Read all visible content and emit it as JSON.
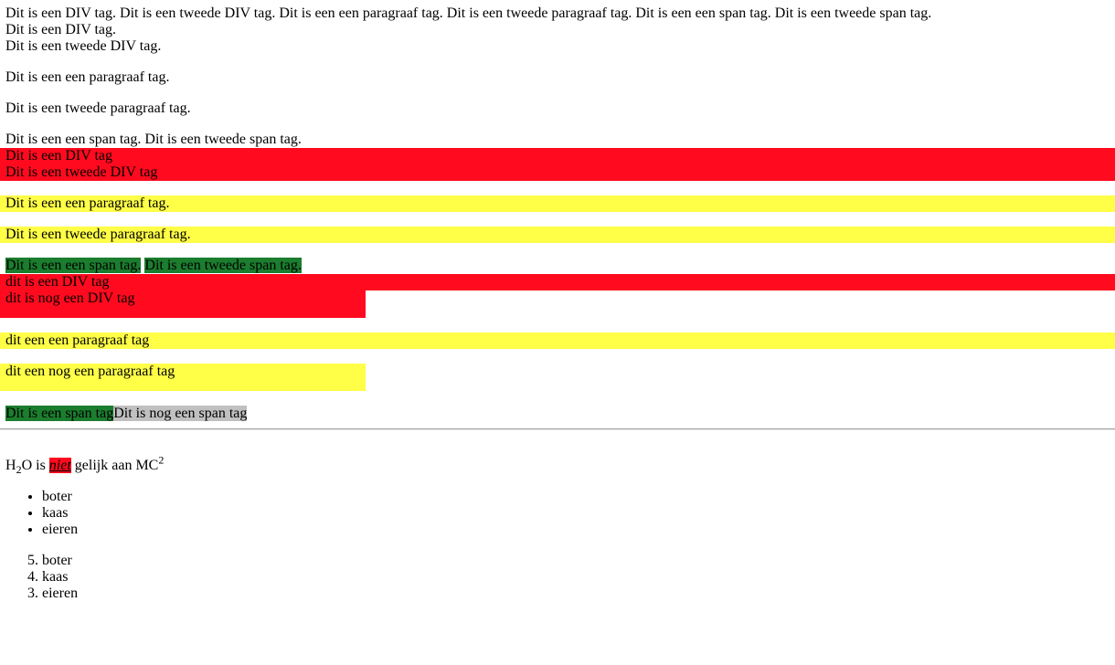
{
  "intro": {
    "combined": "Dit is een DIV tag. Dit is een tweede DIV tag. Dit is een een paragraaf tag. Dit is een tweede paragraaf tag. Dit is een een span tag. Dit is een tweede span tag.",
    "div1": "Dit is een DIV tag.",
    "div2": "Dit is een tweede DIV tag.",
    "p1": "Dit is een een paragraaf tag.",
    "p2": "Dit is een tweede paragraaf tag.",
    "spans": "Dit is een een span tag. Dit is een tweede span tag."
  },
  "styled": {
    "div1": "Dit is een DIV tag",
    "div2": "Dit is een tweede DIV tag",
    "p1": "Dit is een een paragraaf tag.",
    "p2": "Dit is een tweede paragraaf tag.",
    "span1": "Dit is een een span tag.",
    "span2": "Dit is een tweede span tag."
  },
  "third": {
    "div1": "dit is een DIV tag",
    "div2": "dit is nog een DIV tag",
    "p1": "dit een een paragraaf tag",
    "p2": "dit een nog een paragraaf tag",
    "span1": "Dit is een span tag",
    "span2": "Dit is nog een span tag"
  },
  "formula": {
    "h": "H",
    "sub": "2",
    "o_is": "O is ",
    "niet": "niet",
    "rest": " gelijk aan MC",
    "sup": "2"
  },
  "ul": [
    "boter",
    "kaas",
    "eieren"
  ],
  "ol": [
    "boter",
    "kaas",
    "eieren"
  ],
  "colors": {
    "red": "#ff0a1e",
    "yellow": "#ffff47",
    "green": "#1b7d2e",
    "grey": "#c0c0c0"
  }
}
